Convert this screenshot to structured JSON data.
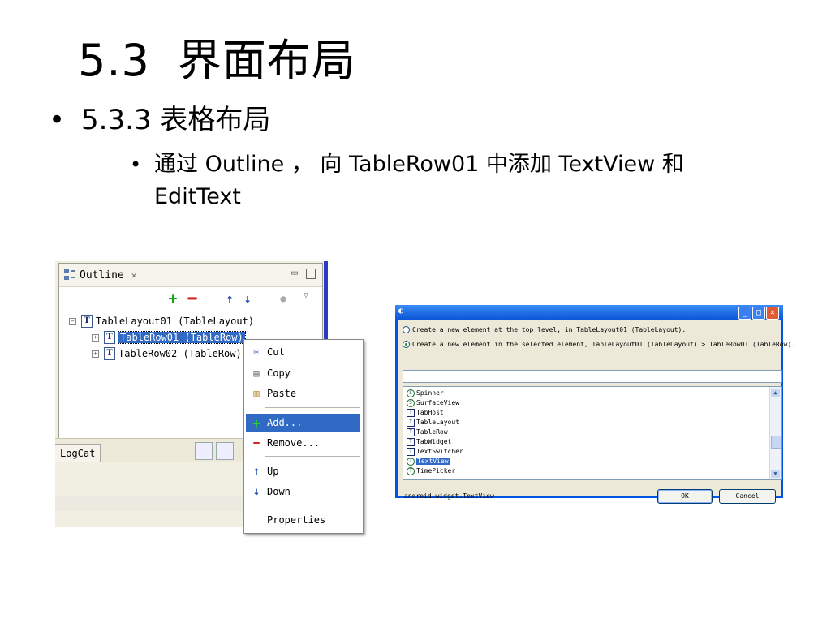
{
  "slide": {
    "title_num": "5.3",
    "title_text": "界面布局",
    "bullet1": "5.3.3  表格布局",
    "bullet2": "通过 Outline ， 向 TableRow01 中添加 TextView 和 EditText"
  },
  "outline_panel": {
    "tab_label": "Outline",
    "tree": [
      {
        "label": "TableLayout01 (TableLayout)"
      },
      {
        "label": "TableRow01 (TableRow)"
      },
      {
        "label": "TableRow02 (TableRow)"
      }
    ],
    "bottom_tab": "LogCat",
    "context_menu": {
      "items": [
        {
          "label": "Cut",
          "icon": "cut-icon"
        },
        {
          "label": "Copy",
          "icon": "copy-icon"
        },
        {
          "label": "Paste",
          "icon": "paste-icon"
        },
        {
          "label": "Add...",
          "icon": "add-icon",
          "highlighted": true
        },
        {
          "label": "Remove...",
          "icon": "remove-icon"
        },
        {
          "label": "Up",
          "icon": "arrow-up-icon"
        },
        {
          "label": "Down",
          "icon": "arrow-down-icon"
        },
        {
          "label": "Properties",
          "icon": ""
        }
      ]
    }
  },
  "dialog": {
    "option_top_level": "Create a new element at the top level, in TableLayout01 (TableLayout).",
    "option_selected": "Create a new element in the selected element, TableLayout01 (TableLayout) > TableRow01 (TableRow).",
    "selected_option": "selected",
    "filter_value": "",
    "items": [
      {
        "label": "Spinner",
        "icon": "S"
      },
      {
        "label": "SurfaceView",
        "icon": "S"
      },
      {
        "label": "TabHost",
        "icon": "T"
      },
      {
        "label": "TableLayout",
        "icon": "T"
      },
      {
        "label": "TableRow",
        "icon": "T"
      },
      {
        "label": "TabWidget",
        "icon": "T"
      },
      {
        "label": "TextSwitcher",
        "icon": "T"
      },
      {
        "label": "TextView",
        "icon": "T",
        "selected": true
      },
      {
        "label": "TimePicker",
        "icon": "T"
      }
    ],
    "status": "android.widget.TextView",
    "ok_label": "OK",
    "cancel_label": "Cancel"
  },
  "colors": {
    "selection": "#316ac5",
    "xp_title": "#0a55d8",
    "add_green": "#1aa31a",
    "remove_red": "#d42020",
    "arrow_blue": "#1a3fb0"
  }
}
